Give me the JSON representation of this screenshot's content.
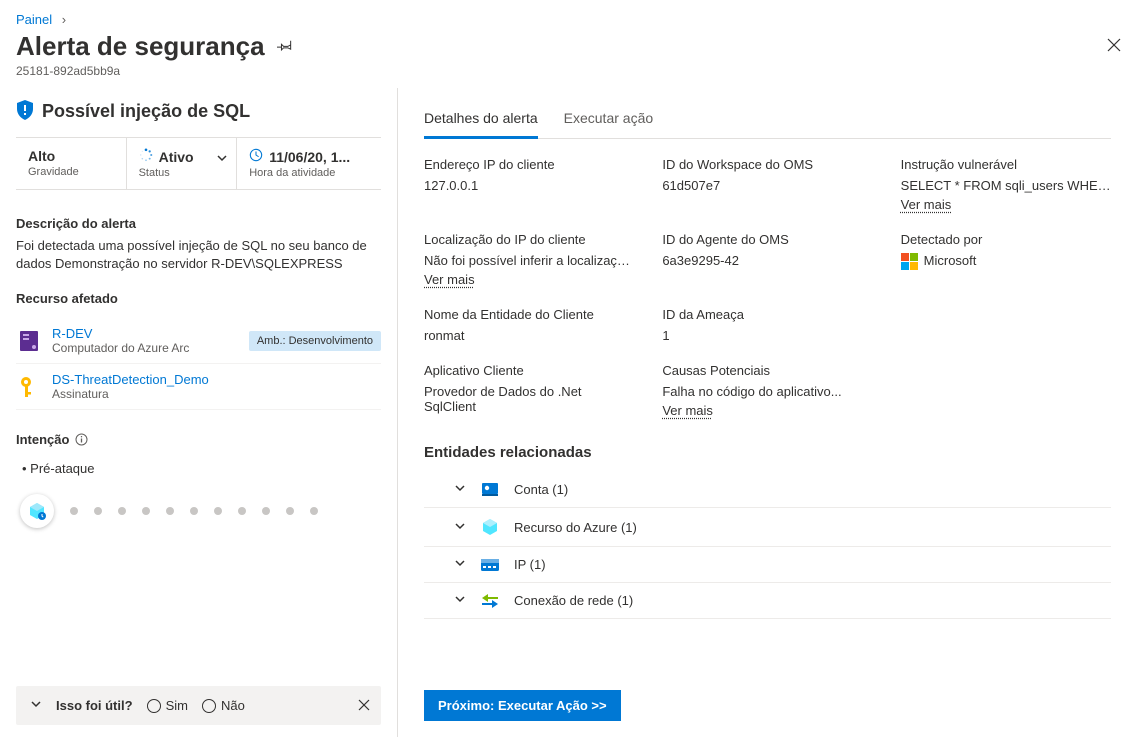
{
  "breadcrumb": {
    "root": "Painel"
  },
  "page": {
    "title": "Alerta de segurança",
    "sub_id": "25181-892ad5bb9a"
  },
  "threat": {
    "title": "Possível injeção de SQL"
  },
  "stats": {
    "severity": {
      "value": "Alto",
      "label": "Gravidade"
    },
    "status": {
      "value": "Ativo",
      "label": "Status"
    },
    "time": {
      "value": "11/06/20, 1...",
      "label": "Hora da atividade"
    }
  },
  "description": {
    "title": "Descrição do alerta",
    "text": "Foi detectada uma possível injeção de SQL no seu banco de dados Demonstração no servidor R-DEV\\SQLEXPRESS"
  },
  "affected": {
    "title": "Recurso afetado",
    "items": [
      {
        "name": "R-DEV",
        "type": "Computador do Azure Arc",
        "env": "Amb.: Desenvolvimento",
        "icon": "server"
      },
      {
        "name": "DS-ThreatDetection_Demo",
        "type": "Assinatura",
        "icon": "key"
      }
    ]
  },
  "intent": {
    "title": "Intenção",
    "item": "Pré-ataque"
  },
  "feedback": {
    "question": "Isso foi útil?",
    "yes": "Sim",
    "no": "Não"
  },
  "tabs": {
    "details": "Detalhes do alerta",
    "action": "Executar ação"
  },
  "details": {
    "client_ip": {
      "label": "Endereço IP do cliente",
      "value": "127.0.0.1"
    },
    "client_ip_loc": {
      "label": "Localização do IP do cliente",
      "value": "Não foi possível inferir a localização ...",
      "more": "Ver mais"
    },
    "client_principal": {
      "label": "Nome da Entidade do Cliente",
      "value": "ronmat"
    },
    "client_app": {
      "label": "Aplicativo Cliente",
      "value": "Provedor de Dados do .Net SqlClient"
    },
    "oms_workspace": {
      "label": "ID do Workspace do OMS",
      "value": "61d507e7"
    },
    "oms_agent": {
      "label": "ID do Agente do OMS",
      "value": "6a3e9295-42"
    },
    "threat_id": {
      "label": "ID da Ameaça",
      "value": "1"
    },
    "causes": {
      "label": "Causas Potenciais",
      "value": "Falha no código do aplicativo...",
      "more": "Ver mais"
    },
    "vuln_stmt": {
      "label": "Instrução vulnerável",
      "value": "SELECT * FROM sqli_users WHERE...",
      "more": "Ver mais"
    },
    "detected_by": {
      "label": "Detectado por",
      "value": "Microsoft"
    }
  },
  "entities": {
    "title": "Entidades relacionadas",
    "rows": [
      {
        "label": "Conta (1)",
        "icon": "account"
      },
      {
        "label": "Recurso do Azure (1)",
        "icon": "azure"
      },
      {
        "label": "IP (1)",
        "icon": "ip"
      },
      {
        "label": "Conexão de rede (1)",
        "icon": "network"
      }
    ]
  },
  "next_button": "Próximo: Executar Ação >>"
}
